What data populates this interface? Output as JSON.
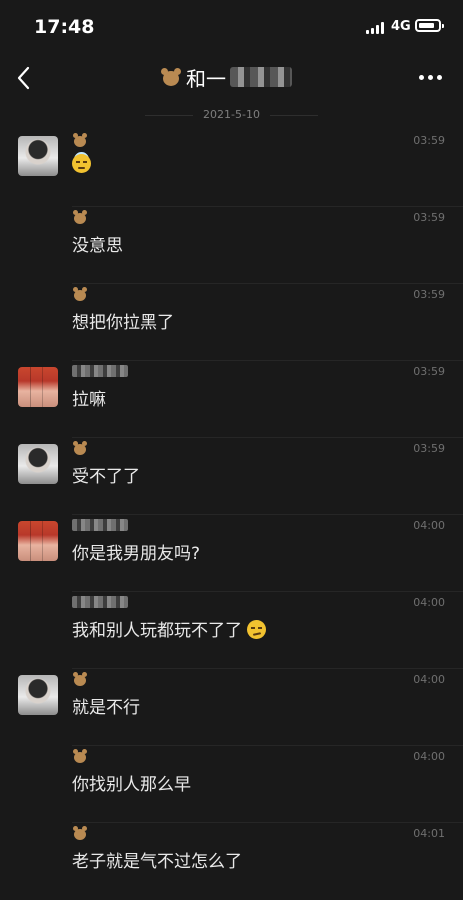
{
  "status": {
    "time": "17:48",
    "network": "4G"
  },
  "nav": {
    "title": "和一"
  },
  "date": "2021-5-10",
  "messages": [
    {
      "text": "",
      "time": "03:59",
      "avatar": "mono",
      "emoji": "smiling-face-with-halo"
    },
    {
      "text": "没意思",
      "time": "03:59"
    },
    {
      "text": "想把你拉黑了",
      "time": "03:59"
    },
    {
      "text": "拉嘛",
      "time": "03:59",
      "avatar": "red"
    },
    {
      "text": "受不了了",
      "time": "03:59",
      "avatar": "mono"
    },
    {
      "text": "你是我男朋友吗?",
      "time": "04:00",
      "avatar": "red"
    },
    {
      "text": "我和别人玩都玩不了了",
      "time": "04:00",
      "emoji": "smirking-face"
    },
    {
      "text": "就是不行",
      "time": "04:00",
      "avatar": "mono"
    },
    {
      "text": "你找别人那么早",
      "time": "04:00"
    },
    {
      "text": "老子就是气不过怎么了",
      "time": "04:01"
    }
  ],
  "colors": {
    "background": "#191919",
    "text": "#e9e9e9",
    "meta": "#6f6f6f"
  }
}
